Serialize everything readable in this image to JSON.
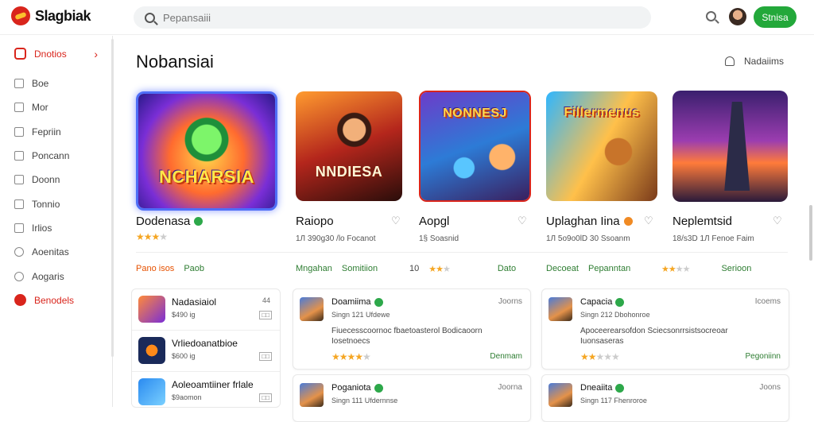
{
  "header": {
    "logo_text": "Slagbiak",
    "search_placeholder": "Pepansaiii",
    "primary_button": "Stnisa"
  },
  "sidebar": {
    "items": [
      {
        "label": "Dnotios",
        "active": true
      },
      {
        "label": "Boe"
      },
      {
        "label": "Mor"
      },
      {
        "label": "Fepriin"
      },
      {
        "label": "Poncann"
      },
      {
        "label": "Doonn"
      },
      {
        "label": "Tonnio"
      },
      {
        "label": "Irlios"
      },
      {
        "label": "Aoenitas"
      },
      {
        "label": "Aogaris"
      },
      {
        "label": "Benodels"
      }
    ]
  },
  "main": {
    "title": "Nobansiai",
    "right_link": "Nadaiims",
    "games": [
      {
        "name": "Dodenasa",
        "art_title": "NCHARSIA",
        "meta": "",
        "tags": [
          "Pano isos",
          "Paob"
        ],
        "rating": 3
      },
      {
        "name": "Raiopo",
        "art_title": "NNDIESA",
        "meta": "1Л 390g30 /lo Focanot",
        "tags": [
          "Mngahan",
          "Somitiion"
        ],
        "rating": 0
      },
      {
        "name": "Aopgl",
        "art_title": "NONNESJ",
        "meta": "1§ Soasnid",
        "tags": [
          "10",
          "Dato"
        ],
        "rating": 2
      },
      {
        "name": "Uplaghan Iina",
        "art_title": "Fillermenus",
        "meta": "1Л 5o9o0lD 30 Ssoanm",
        "tags": [
          "Decoeat",
          "Pepanntan"
        ],
        "rating": 0
      },
      {
        "name": "Neplemtsid",
        "art_title": "",
        "meta": "18/s3D 1Л Fenoe Faim",
        "tags": [
          "Serioon"
        ],
        "rating": 2
      }
    ],
    "list": [
      {
        "title": "Nadasiaiol",
        "meta": "$490 ig",
        "count": "44"
      },
      {
        "title": "Vrliedoanatbioe",
        "meta": "$600 ig",
        "count": ""
      },
      {
        "title": "Aoleoamtiiner frlale",
        "meta": "$9aomon",
        "count": ""
      }
    ],
    "reviews": [
      {
        "name": "Doamiima",
        "link": "Joorns",
        "meta": "Singn 121 Ufdewe",
        "text": "Fiuecesscoornoc fbaetoasterol Bodicaoorn Iosetnoecs",
        "rating": 4,
        "action": "Denmam"
      },
      {
        "name": "Capacia",
        "link": "Icoems",
        "meta": "Singn 212 Dbohonroe",
        "text": "Apoceerearsofdon Sciecsonrrsistsocreoar Iuonsaseras",
        "rating": 2,
        "action": "Pegoniinn"
      },
      {
        "name": "Poganiota",
        "link": "Joorna",
        "meta": "Singn 111 Ufdernnse",
        "text": "",
        "rating": 0,
        "action": ""
      },
      {
        "name": "Dneaiita",
        "link": "Joons",
        "meta": "Singn 117 Fhenroroe",
        "text": "",
        "rating": 0,
        "action": ""
      }
    ]
  },
  "colors": {
    "accent": "#d9251c",
    "primary_button": "#23a83a",
    "featured_border": "#4f6ef7",
    "star": "#f5a623",
    "tag_green": "#2e7d32"
  }
}
